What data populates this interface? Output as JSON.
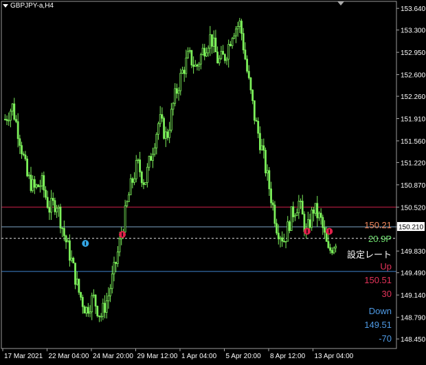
{
  "header": {
    "symbol": "GBPJPY-a,H4"
  },
  "chart_data": {
    "type": "candlestick",
    "ylim": [
      148.3,
      153.75
    ],
    "y_ticks": [
      "153.640",
      "153.300",
      "152.950",
      "152.600",
      "152.260",
      "151.910",
      "151.560",
      "151.220",
      "150.870",
      "150.520",
      "150.210",
      "149.830",
      "149.490",
      "149.140",
      "148.790",
      "148.450"
    ],
    "x_ticks": [
      "17 Mar 2021",
      "22 Mar 04:00",
      "24 Mar 20:00",
      "29 Mar 12:00",
      "1 Apr 04:00",
      "5 Apr 20:00",
      "8 Apr 12:00",
      "13 Apr 04:00"
    ],
    "current_price": "150.210",
    "lines": [
      {
        "price": 150.52,
        "color": "#d0214a",
        "style": "solid"
      },
      {
        "price": 150.21,
        "color": "#7fa8c8",
        "style": "solid"
      },
      {
        "price": 150.03,
        "color": "#e8e8e8",
        "style": "dashed"
      },
      {
        "price": 149.51,
        "color": "#3f86d1",
        "style": "solid"
      }
    ],
    "close_path": [
      151.9,
      152.1,
      151.6,
      151.0,
      150.8,
      150.9,
      150.5,
      150.6,
      150.1,
      149.7,
      149.2,
      148.9,
      149.1,
      148.8,
      149.1,
      149.6,
      150.2,
      150.8,
      151.2,
      150.9,
      151.4,
      151.9,
      151.6,
      152.2,
      152.6,
      152.9,
      152.7,
      153.0,
      153.2,
      152.8,
      152.9,
      153.3,
      153.4,
      152.6,
      151.9,
      151.4,
      150.8,
      150.2,
      150.0,
      150.4,
      150.6,
      150.1,
      150.5,
      150.3,
      149.8,
      150.0
    ],
    "arrows": [
      {
        "index": 11,
        "price": 149.95,
        "color": "#33a6e6",
        "dir": "up"
      },
      {
        "index": 16,
        "price": 150.09,
        "color": "#e0204a",
        "dir": "down"
      },
      {
        "index": 41,
        "price": 150.14,
        "color": "#e0204a",
        "dir": "down"
      },
      {
        "index": 44,
        "price": 150.14,
        "color": "#e0204a",
        "dir": "down"
      }
    ],
    "colors": {
      "candle": "#7cf05a",
      "grid": "#555555",
      "axis_text": "#ffffff",
      "price_box": "#ffffff"
    }
  },
  "indicator": [
    {
      "text": "150.21",
      "color": "#f28a5e"
    },
    {
      "text": "20.9P",
      "color": "#6ee06e"
    },
    {
      "text": "設定レート",
      "color": "#ffffff"
    },
    {
      "text": "Up",
      "color": "#e5335a"
    },
    {
      "text": "150.51",
      "color": "#e5335a"
    },
    {
      "text": "30",
      "color": "#e5335a"
    },
    {
      "text": "Down",
      "color": "#4f9be6"
    },
    {
      "text": "149.51",
      "color": "#4f9be6"
    },
    {
      "text": "-70",
      "color": "#4f9be6"
    }
  ]
}
